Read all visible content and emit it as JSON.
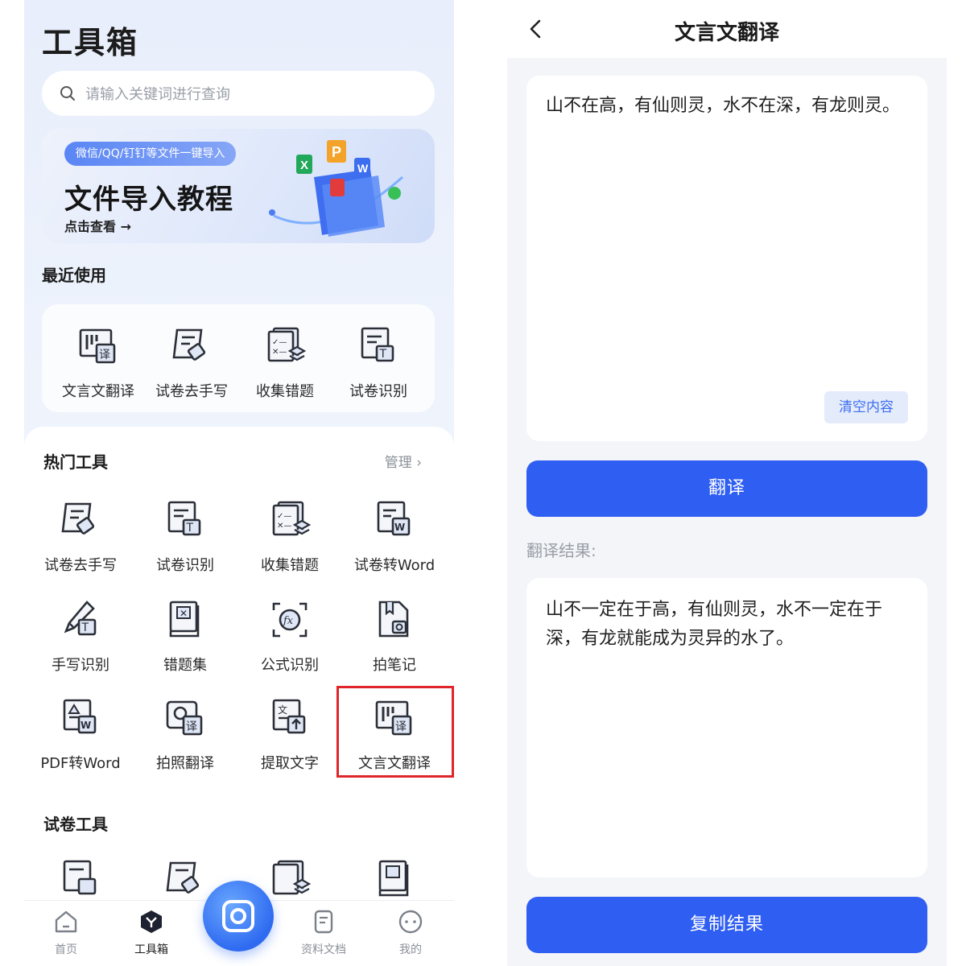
{
  "left": {
    "title": "工具箱",
    "search": {
      "placeholder": "请输入关键词进行查询",
      "icon": "search-icon"
    },
    "banner": {
      "tag": "微信/QQ/钉钉等文件一键导入",
      "headline": "文件导入教程",
      "cta": "点击查看 →"
    },
    "recent": {
      "heading": "最近使用",
      "items": [
        {
          "label": "文言文翻译",
          "icon": "classical-translate-icon"
        },
        {
          "label": "试卷去手写",
          "icon": "erase-handwriting-icon"
        },
        {
          "label": "收集错题",
          "icon": "collect-mistakes-icon"
        },
        {
          "label": "试卷识别",
          "icon": "paper-recognition-icon"
        }
      ]
    },
    "hot": {
      "heading": "热门工具",
      "manage": "管理 ›",
      "items": [
        {
          "label": "试卷去手写",
          "icon": "erase-handwriting-icon"
        },
        {
          "label": "试卷识别",
          "icon": "paper-recognition-icon"
        },
        {
          "label": "收集错题",
          "icon": "collect-mistakes-icon"
        },
        {
          "label": "试卷转Word",
          "icon": "paper-to-word-icon"
        },
        {
          "label": "手写识别",
          "icon": "handwriting-recognition-icon"
        },
        {
          "label": "错题集",
          "icon": "mistake-book-icon"
        },
        {
          "label": "公式识别",
          "icon": "formula-recognition-icon"
        },
        {
          "label": "拍笔记",
          "icon": "photo-notes-icon"
        },
        {
          "label": "PDF转Word",
          "icon": "pdf-to-word-icon"
        },
        {
          "label": "拍照翻译",
          "icon": "photo-translate-icon"
        },
        {
          "label": "提取文字",
          "icon": "extract-text-icon"
        },
        {
          "label": "文言文翻译",
          "icon": "classical-translate-icon"
        }
      ],
      "highlighted": "文言文翻译"
    },
    "exam": {
      "heading": "试卷工具"
    },
    "tabs": [
      {
        "label": "首页",
        "icon": "home-icon"
      },
      {
        "label": "工具箱",
        "icon": "toolbox-icon",
        "active": true
      },
      {
        "label": "资料文档",
        "icon": "documents-icon"
      },
      {
        "label": "我的",
        "icon": "profile-icon"
      }
    ],
    "highlight_color": "#e0262b"
  },
  "right": {
    "title": "文言文翻译",
    "input_text": "山不在高，有仙则灵，水不在深，有龙则灵。",
    "clear_label": "清空内容",
    "translate_label": "翻译",
    "result_label": "翻译结果:",
    "result_text": "山不一定在于高，有仙则灵，水不一定在于深，有龙就能成为灵异的水了。",
    "copy_label": "复制结果",
    "accent": "#2f5ef2"
  }
}
